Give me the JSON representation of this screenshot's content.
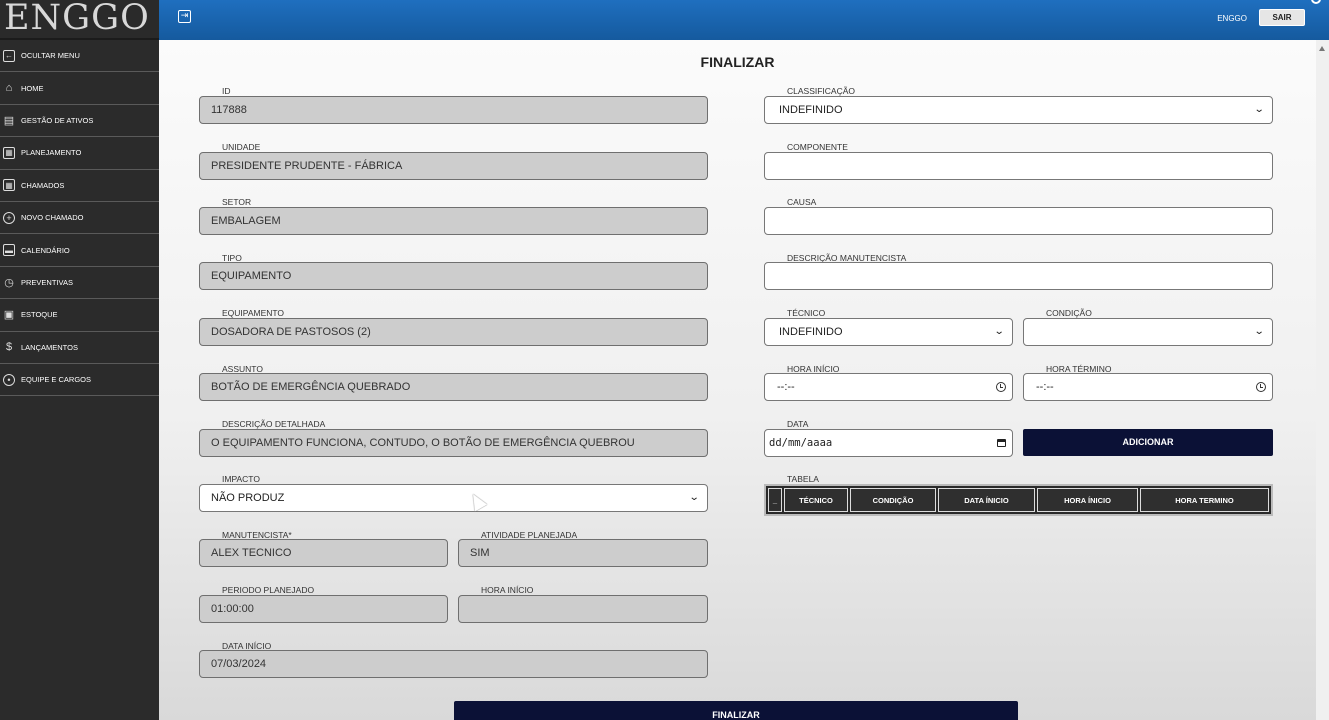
{
  "app": {
    "logo": "ENGGO"
  },
  "header": {
    "user": "ENGGO",
    "logout_label": "SAIR",
    "menu_toggle_icon": "sidebar-toggle-icon"
  },
  "sidebar": {
    "items": [
      {
        "label": "OCULTAR MENU",
        "icon": "collapse-menu-icon"
      },
      {
        "label": "HOME",
        "icon": "home-icon"
      },
      {
        "label": "GESTÃO DE ATIVOS",
        "icon": "car-icon"
      },
      {
        "label": "PLANEJAMENTO",
        "icon": "calendar-grid-icon"
      },
      {
        "label": "CHAMADOS",
        "icon": "list-grid-icon"
      },
      {
        "label": "NOVO CHAMADO",
        "icon": "plus-circle-icon"
      },
      {
        "label": "CALENDÁRIO",
        "icon": "calendar-icon"
      },
      {
        "label": "PREVENTIVAS",
        "icon": "alarm-clock-icon"
      },
      {
        "label": "ESTOQUE",
        "icon": "inbox-icon"
      },
      {
        "label": "LANÇAMENTOS",
        "icon": "dollar-icon"
      },
      {
        "label": "EQUIPE E CARGOS",
        "icon": "shield-icon"
      }
    ]
  },
  "page": {
    "title": "FINALIZAR"
  },
  "left": {
    "id": {
      "label": "ID",
      "value": "117888"
    },
    "unidade": {
      "label": "UNIDADE",
      "value": "PRESIDENTE PRUDENTE - FÁBRICA"
    },
    "setor": {
      "label": "SETOR",
      "value": "EMBALAGEM"
    },
    "tipo": {
      "label": "TIPO",
      "value": "EQUIPAMENTO"
    },
    "equipamento": {
      "label": "EQUIPAMENTO",
      "value": "DOSADORA DE PASTOSOS (2)"
    },
    "assunto": {
      "label": "ASSUNTO",
      "value": "BOTÃO DE EMERGÊNCIA QUEBRADO"
    },
    "descricao": {
      "label": "DESCRIÇÃO DETALHADA",
      "value": "O EQUIPAMENTO FUNCIONA, CONTUDO, O BOTÃO DE EMERGÊNCIA QUEBROU"
    },
    "impacto": {
      "label": "IMPACTO",
      "value": "NÃO PRODUZ"
    },
    "manutencista": {
      "label": "MANUTENCISTA*",
      "value": "ALEX TECNICO"
    },
    "atividade": {
      "label": "ATIVIDADE PLANEJADA",
      "value": "SIM"
    },
    "periodo": {
      "label": "PERIODO PLANEJADO",
      "value": "01:00:00"
    },
    "hora_inicio": {
      "label": "HORA INÍCIO",
      "value": ""
    },
    "data_inicio": {
      "label": "DATA INÍCIO",
      "value": "07/03/2024"
    }
  },
  "right": {
    "classificacao": {
      "label": "CLASSIFICAÇÃO",
      "value": "INDEFINIDO"
    },
    "componente": {
      "label": "COMPONENTE",
      "value": ""
    },
    "causa": {
      "label": "CAUSA",
      "value": ""
    },
    "descricao_manut": {
      "label": "DESCRIÇÃO MANUTENCISTA",
      "value": ""
    },
    "tecnico": {
      "label": "TÉCNICO",
      "value": "INDEFINIDO"
    },
    "condicao": {
      "label": "CONDIÇÃO",
      "value": ""
    },
    "hora_inicio": {
      "label": "HORA INÍCIO",
      "value": "--:--"
    },
    "hora_termino": {
      "label": "HORA TÉRMINO",
      "value": "--:--"
    },
    "data": {
      "label": "DATA",
      "value": "dd/mm/aaaa"
    },
    "add_label": "ADICIONAR",
    "tabela": {
      "label": "TABELA",
      "columns": [
        "_",
        "TÉCNICO",
        "CONDIÇÃO",
        "DATA ÍNICIO",
        "HORA ÍNICIO",
        "HORA TERMINO"
      ]
    }
  },
  "actions": {
    "finalize_label": "FINALIZAR"
  },
  "colors": {
    "topbar": "#1f6fbf",
    "sidebar": "#2b2b2b",
    "button_dark": "#0b1136",
    "readonly_field": "#cdcdcd"
  }
}
